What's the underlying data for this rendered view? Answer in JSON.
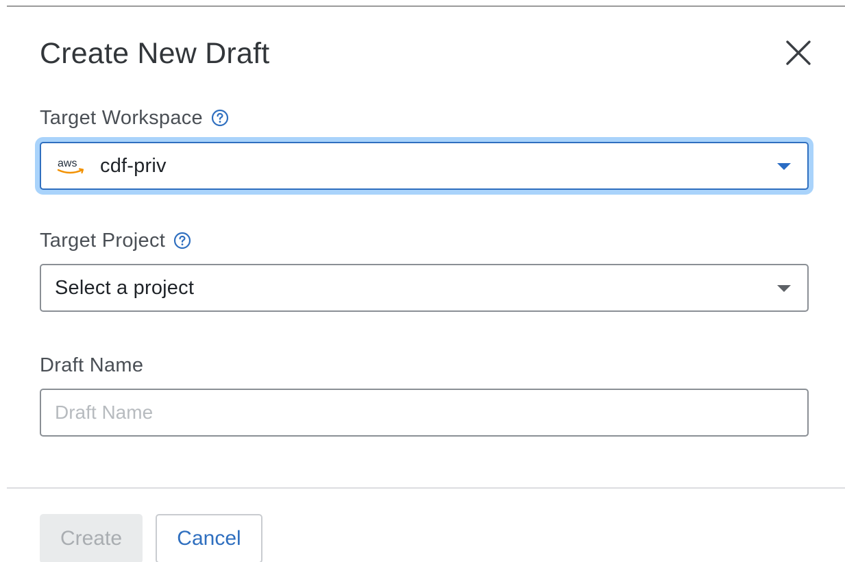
{
  "dialog": {
    "title": "Create New Draft",
    "close_icon": "close-icon"
  },
  "workspace": {
    "label": "Target Workspace",
    "help_icon": "help-icon",
    "value": "cdf-priv",
    "provider_icon": "aws-logo-icon",
    "focused": true
  },
  "project": {
    "label": "Target Project",
    "help_icon": "help-icon",
    "value": "Select a project"
  },
  "draft_name": {
    "label": "Draft Name",
    "placeholder": "Draft Name",
    "value": ""
  },
  "footer": {
    "create_label": "Create",
    "cancel_label": "Cancel",
    "create_disabled": true
  },
  "colors": {
    "accent": "#2f6fbf",
    "focus_ring": "#a9d3fb",
    "aws_orange": "#f29100",
    "disabled_bg": "#e9ebec"
  }
}
